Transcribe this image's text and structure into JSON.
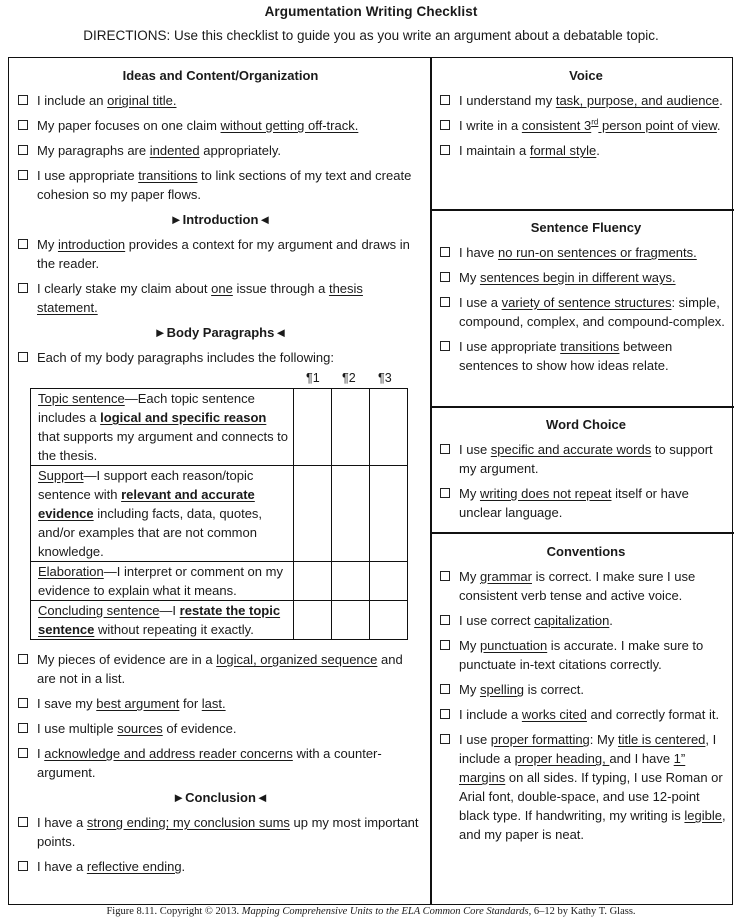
{
  "header": {
    "title": "Argumentation Writing Checklist",
    "directions": "DIRECTIONS: Use this checklist to guide you as you write an argument about a debatable topic."
  },
  "icons": {
    "checkbox": "☐",
    "arrow_right": "►",
    "arrow_left": "◄"
  },
  "left": {
    "heading": "Ideas and Content/Organization",
    "items": [
      {
        "parts": [
          [
            "I include an ",
            ""
          ],
          [
            "original title.",
            "u"
          ]
        ]
      },
      {
        "parts": [
          [
            "My paper focuses on one claim ",
            ""
          ],
          [
            "without getting off-track.",
            "u"
          ]
        ]
      },
      {
        "parts": [
          [
            "My paragraphs are ",
            ""
          ],
          [
            "indented",
            "u"
          ],
          [
            " appropriately.",
            ""
          ]
        ]
      },
      {
        "parts": [
          [
            "I use appropriate ",
            ""
          ],
          [
            "transitions",
            "u"
          ],
          [
            " to link sections of my text and create cohesion so my paper flows.",
            ""
          ]
        ]
      }
    ],
    "introduction": {
      "heading": "Introduction",
      "items": [
        {
          "parts": [
            [
              "My ",
              ""
            ],
            [
              "introduction",
              "u"
            ],
            [
              " provides a context for my argument and draws in the reader.",
              ""
            ]
          ]
        },
        {
          "parts": [
            [
              "I clearly stake my claim about ",
              ""
            ],
            [
              "one",
              "u"
            ],
            [
              " issue through a ",
              ""
            ],
            [
              "thesis statement.",
              "u"
            ]
          ]
        }
      ]
    },
    "body": {
      "heading": "Body Paragraphs",
      "lead_item": "Each of my body paragraphs includes the following:",
      "columns": [
        "¶1",
        "¶2",
        "¶3"
      ],
      "rows": [
        {
          "parts": [
            [
              "Topic sentence",
              "u"
            ],
            [
              "—Each topic sentence includes a ",
              ""
            ],
            [
              "logical and specific reason",
              "bu"
            ],
            [
              " that supports my argument and connects to the thesis.",
              ""
            ]
          ]
        },
        {
          "parts": [
            [
              "Support",
              "u"
            ],
            [
              "—I support each reason/topic sentence with ",
              ""
            ],
            [
              "relevant and accurate evidence",
              "bu"
            ],
            [
              " including facts, data, quotes, and/or examples that are not common knowledge.",
              ""
            ]
          ]
        },
        {
          "parts": [
            [
              "Elaboration",
              "u"
            ],
            [
              "—I  interpret or comment on my evidence to explain what it means.",
              ""
            ]
          ]
        },
        {
          "parts": [
            [
              "Concluding sentence",
              "u"
            ],
            [
              "—I ",
              ""
            ],
            [
              "restate the topic sentence",
              "bu"
            ],
            [
              " without repeating it exactly.",
              ""
            ]
          ]
        }
      ],
      "items": [
        {
          "parts": [
            [
              "My pieces of evidence are in a ",
              ""
            ],
            [
              "logical, organized sequence",
              "u"
            ],
            [
              " and are not in a list.",
              ""
            ]
          ]
        },
        {
          "parts": [
            [
              "I save my ",
              ""
            ],
            [
              "best argument",
              "u"
            ],
            [
              " for ",
              ""
            ],
            [
              "last.",
              "u"
            ]
          ]
        },
        {
          "parts": [
            [
              "I use multiple ",
              ""
            ],
            [
              "sources",
              "u"
            ],
            [
              " of evidence.",
              ""
            ]
          ]
        },
        {
          "parts": [
            [
              "I ",
              ""
            ],
            [
              "acknowledge and address reader concerns",
              "u"
            ],
            [
              " with a counter-argument.",
              ""
            ]
          ]
        }
      ]
    },
    "conclusion": {
      "heading": "Conclusion",
      "items": [
        {
          "parts": [
            [
              "I have a ",
              ""
            ],
            [
              "strong ending; my conclusion sums",
              "u"
            ],
            [
              " up my most important points.",
              ""
            ]
          ]
        },
        {
          "parts": [
            [
              "I have a ",
              ""
            ],
            [
              "reflective ending",
              "u"
            ],
            [
              ".",
              ""
            ]
          ]
        }
      ]
    }
  },
  "right": {
    "sections": [
      {
        "heading": "Voice",
        "items": [
          {
            "parts": [
              [
                "I understand my ",
                ""
              ],
              [
                "task, purpose, and audience",
                "u"
              ],
              [
                ".",
                ""
              ]
            ]
          },
          {
            "parts": [
              [
                "I write in a ",
                ""
              ],
              [
                "consistent 3",
                "u"
              ],
              [
                "rd",
                "usup"
              ],
              [
                " person point of view",
                "u"
              ],
              [
                ".",
                ""
              ]
            ]
          },
          {
            "parts": [
              [
                "I maintain a ",
                ""
              ],
              [
                "formal style",
                "u"
              ],
              [
                ".",
                ""
              ]
            ]
          }
        ]
      },
      {
        "heading": "Sentence Fluency",
        "items": [
          {
            "parts": [
              [
                "I have ",
                ""
              ],
              [
                "no run-on sentences or fragments.",
                "u"
              ]
            ]
          },
          {
            "parts": [
              [
                "My ",
                ""
              ],
              [
                "sentences begin in different ways.",
                "u"
              ]
            ]
          },
          {
            "parts": [
              [
                "I use a ",
                ""
              ],
              [
                "variety of sentence structures",
                "u"
              ],
              [
                ": simple, compound, complex, and compound-complex.",
                ""
              ]
            ]
          },
          {
            "parts": [
              [
                "I use appropriate ",
                ""
              ],
              [
                "transitions",
                "u"
              ],
              [
                " between sentences to show how ideas relate.",
                ""
              ]
            ]
          }
        ]
      },
      {
        "heading": "Word Choice",
        "items": [
          {
            "parts": [
              [
                "I use ",
                ""
              ],
              [
                "specific and accurate words",
                "u"
              ],
              [
                " to support my argument.",
                ""
              ]
            ]
          },
          {
            "parts": [
              [
                "My ",
                ""
              ],
              [
                "writing does not repeat",
                "u"
              ],
              [
                " itself or have unclear language.",
                ""
              ]
            ]
          }
        ]
      },
      {
        "heading": "Conventions",
        "items": [
          {
            "parts": [
              [
                "My ",
                ""
              ],
              [
                "grammar",
                "u"
              ],
              [
                " is correct. I make sure I use consistent verb tense and active voice.",
                ""
              ]
            ]
          },
          {
            "parts": [
              [
                "I use correct ",
                ""
              ],
              [
                "capitalization",
                "u"
              ],
              [
                ".",
                ""
              ]
            ]
          },
          {
            "parts": [
              [
                "My ",
                ""
              ],
              [
                "punctuation",
                "u"
              ],
              [
                " is accurate. I make sure to punctuate in-text citations correctly.",
                ""
              ]
            ]
          },
          {
            "parts": [
              [
                "My ",
                ""
              ],
              [
                "spelling",
                "u"
              ],
              [
                " is correct.",
                ""
              ]
            ]
          },
          {
            "parts": [
              [
                "I include a ",
                ""
              ],
              [
                "works cited",
                "u"
              ],
              [
                " and correctly format it.",
                ""
              ]
            ]
          },
          {
            "parts": [
              [
                "I use ",
                ""
              ],
              [
                "proper formatting",
                "u"
              ],
              [
                ":  My ",
                ""
              ],
              [
                "title is centered",
                "u"
              ],
              [
                ", I include a ",
                ""
              ],
              [
                "proper heading, ",
                "u"
              ],
              [
                "and I have ",
                ""
              ],
              [
                "1” margins",
                "u"
              ],
              [
                " on all sides. If typing, I use Roman or Arial font, double-space, and use 12-point black type.  If handwriting, my writing is ",
                ""
              ],
              [
                "legible",
                "u"
              ],
              [
                ", and my paper is neat.",
                ""
              ]
            ]
          }
        ]
      }
    ]
  },
  "caption": {
    "prefix": "Figure 8.11. Copyright © 2013. ",
    "book": "Mapping Comprehensive Units to the ELA Common Core Standards,",
    "suffix": " 6–12 by Kathy T. Glass."
  }
}
